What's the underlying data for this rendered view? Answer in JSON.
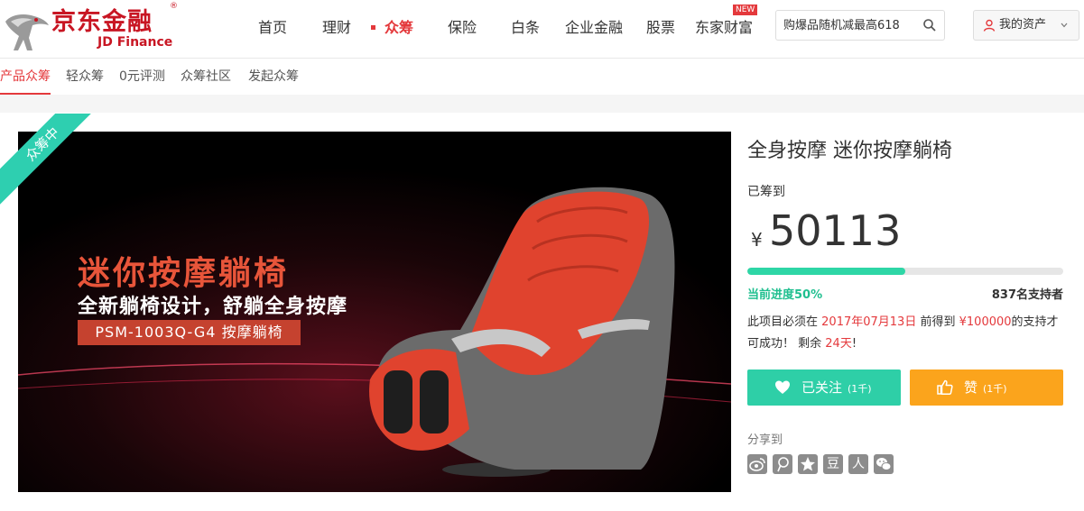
{
  "brand": {
    "name_cn": "京东金融",
    "name_en": "JD Finance",
    "registered": "®",
    "color": "#c81623"
  },
  "nav": {
    "items": [
      {
        "label": "首页"
      },
      {
        "label": "理财"
      },
      {
        "label": "众筹",
        "active": true
      },
      {
        "label": "保险"
      },
      {
        "label": "白条"
      },
      {
        "label": "企业金融"
      },
      {
        "label": "股票"
      },
      {
        "label": "东家财富",
        "badge": "NEW"
      }
    ],
    "accent": "#e4393c"
  },
  "search": {
    "placeholder": "购爆品随机减最高618",
    "icon": "search-icon"
  },
  "account": {
    "label": "我的资产",
    "icon": "user-icon"
  },
  "subnav": {
    "items": [
      {
        "label": "产品众筹",
        "active": true
      },
      {
        "label": "轻众筹"
      },
      {
        "label": "0元评测"
      },
      {
        "label": "众筹社区"
      },
      {
        "label": "发起众筹"
      }
    ]
  },
  "banner": {
    "ribbon": "众筹中",
    "title": "迷你按摩躺椅",
    "subtitle": "全新躺椅设计，舒躺全身按摩",
    "model": "PSM-1003Q-G4 按摩躺椅",
    "ribbon_color": "#2ecfb0"
  },
  "product": {
    "title": "全身按摩 迷你按摩躺椅",
    "raised_label": "已筹到",
    "currency": "¥",
    "amount": "50113",
    "progress": 0.5,
    "progress_label": "当前进度50%",
    "supporters": "837名支持者",
    "desc": {
      "p1": "此项目必须在",
      "date": "2017年07月13日",
      "p2": "前得到",
      "target": "¥100000",
      "p3": "的支持才可成功！ 剩余",
      "days": "24天",
      "p4": "!"
    },
    "follow": {
      "label": "已关注",
      "count": "(1千)",
      "icon": "heart-icon",
      "color": "#2ecfa7"
    },
    "like": {
      "label": "赞",
      "count": "(1千)",
      "icon": "thumbs-up-icon",
      "color": "#fba41c"
    },
    "share_label": "分享到",
    "share": [
      {
        "icon": "weibo-icon"
      },
      {
        "icon": "qq-weibo-icon"
      },
      {
        "icon": "qzone-icon"
      },
      {
        "icon": "douban-icon",
        "text": "豆"
      },
      {
        "icon": "renren-icon",
        "text": "人"
      },
      {
        "icon": "wechat-icon"
      }
    ]
  }
}
